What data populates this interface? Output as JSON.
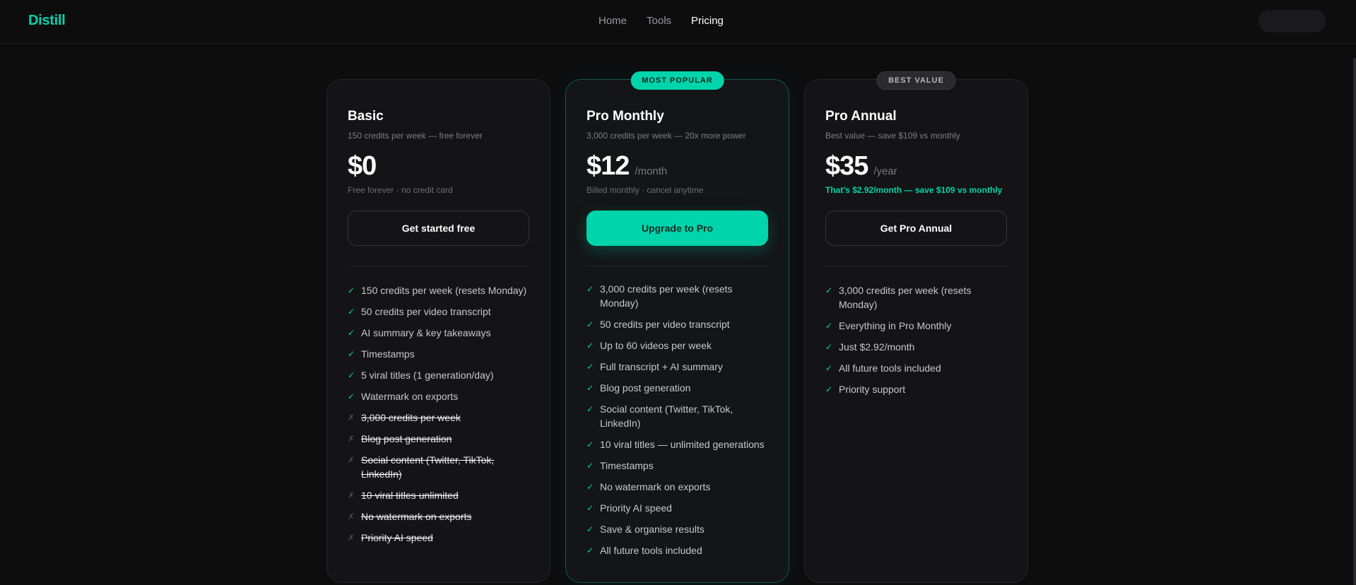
{
  "brand": {
    "name": "Distill",
    "accent": "#00d4aa"
  },
  "nav": {
    "items": [
      "Home",
      "Tools",
      "Pricing"
    ],
    "active": "Pricing"
  },
  "plans": [
    {
      "name": "Basic",
      "subtitle": "150 credits per week — free forever",
      "price": "$0",
      "period": "",
      "note": "Free forever · no credit card",
      "cta": "Get started free",
      "badge": "",
      "features": [
        {
          "text": "150 credits per week (resets Monday)",
          "included": true
        },
        {
          "text": "50 credits per video transcript",
          "included": true
        },
        {
          "text": "AI summary & key takeaways",
          "included": true
        },
        {
          "text": "Timestamps",
          "included": true
        },
        {
          "text": "5 viral titles (1 generation/day)",
          "included": true
        },
        {
          "text": "Watermark on exports",
          "included": true
        },
        {
          "text": "3,000 credits per week",
          "included": false
        },
        {
          "text": "Blog post generation",
          "included": false
        },
        {
          "text": "Social content (Twitter, TikTok, LinkedIn)",
          "included": false
        },
        {
          "text": "10 viral titles unlimited",
          "included": false
        },
        {
          "text": "No watermark on exports",
          "included": false
        },
        {
          "text": "Priority AI speed",
          "included": false
        }
      ]
    },
    {
      "name": "Pro Monthly",
      "subtitle": "3,000 credits per week — 20x more power",
      "price": "$12",
      "period": "/month",
      "note": "Billed monthly · cancel anytime",
      "cta": "Upgrade to Pro",
      "badge": "MOST POPULAR",
      "features": [
        {
          "text": "3,000 credits per week (resets Monday)",
          "included": true
        },
        {
          "text": "50 credits per video transcript",
          "included": true
        },
        {
          "text": "Up to 60 videos per week",
          "included": true
        },
        {
          "text": "Full transcript + AI summary",
          "included": true
        },
        {
          "text": "Blog post generation",
          "included": true
        },
        {
          "text": "Social content (Twitter, TikTok, LinkedIn)",
          "included": true
        },
        {
          "text": "10 viral titles — unlimited generations",
          "included": true
        },
        {
          "text": "Timestamps",
          "included": true
        },
        {
          "text": "No watermark on exports",
          "included": true
        },
        {
          "text": "Priority AI speed",
          "included": true
        },
        {
          "text": "Save & organise results",
          "included": true
        },
        {
          "text": "All future tools included",
          "included": true
        }
      ]
    },
    {
      "name": "Pro Annual",
      "subtitle": "Best value — save $109 vs monthly",
      "price": "$35",
      "period": "/year",
      "note": "That's $2.92/month — save $109 vs monthly",
      "cta": "Get Pro Annual",
      "badge": "BEST VALUE",
      "features": [
        {
          "text": "3,000 credits per week (resets Monday)",
          "included": true
        },
        {
          "text": "Everything in Pro Monthly",
          "included": true
        },
        {
          "text": "Just $2.92/month",
          "included": true
        },
        {
          "text": "All future tools included",
          "included": true
        },
        {
          "text": "Priority support",
          "included": true
        }
      ]
    }
  ],
  "icons": {
    "check": "check-icon",
    "cross": "cross-icon"
  },
  "marks": {
    "check": "✓",
    "cross": "✗"
  }
}
